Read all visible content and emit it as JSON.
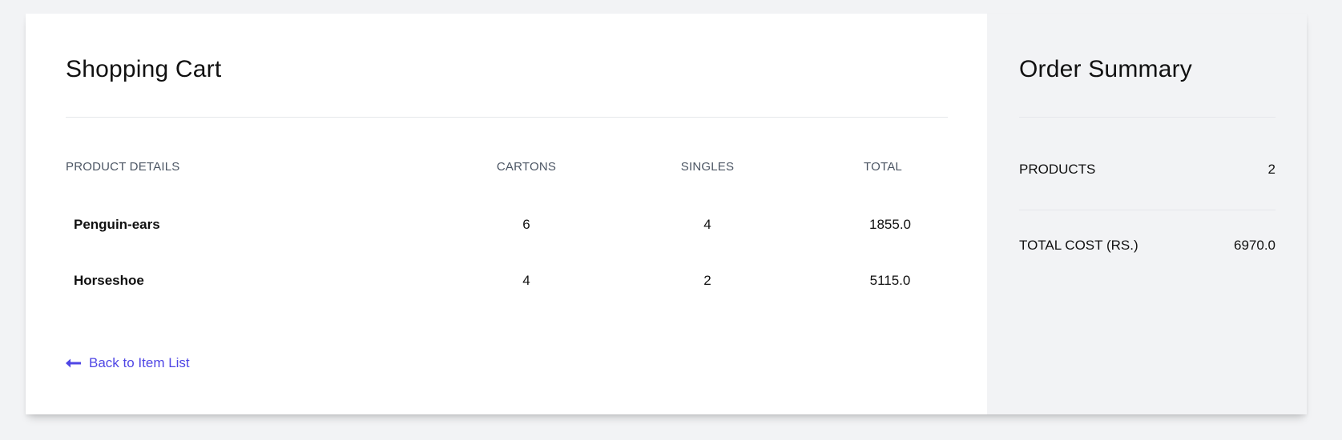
{
  "cart": {
    "title": "Shopping Cart",
    "columns": {
      "product": "PRODUCT DETAILS",
      "cartons": "CARTONS",
      "singles": "SINGLES",
      "total": "TOTAL"
    },
    "items": [
      {
        "name": "Penguin-ears",
        "cartons": "6",
        "singles": "4",
        "total": "1855.0"
      },
      {
        "name": "Horseshoe",
        "cartons": "4",
        "singles": "2",
        "total": "5115.0"
      }
    ],
    "back_link": {
      "label": "Back to Item List",
      "icon": "arrow-left-icon",
      "color": "#4f46e5"
    }
  },
  "summary": {
    "title": "Order Summary",
    "products_label": "PRODUCTS",
    "products_count": "2",
    "total_cost_label": "TOTAL COST (RS.)",
    "total_cost_value": "6970.0"
  }
}
